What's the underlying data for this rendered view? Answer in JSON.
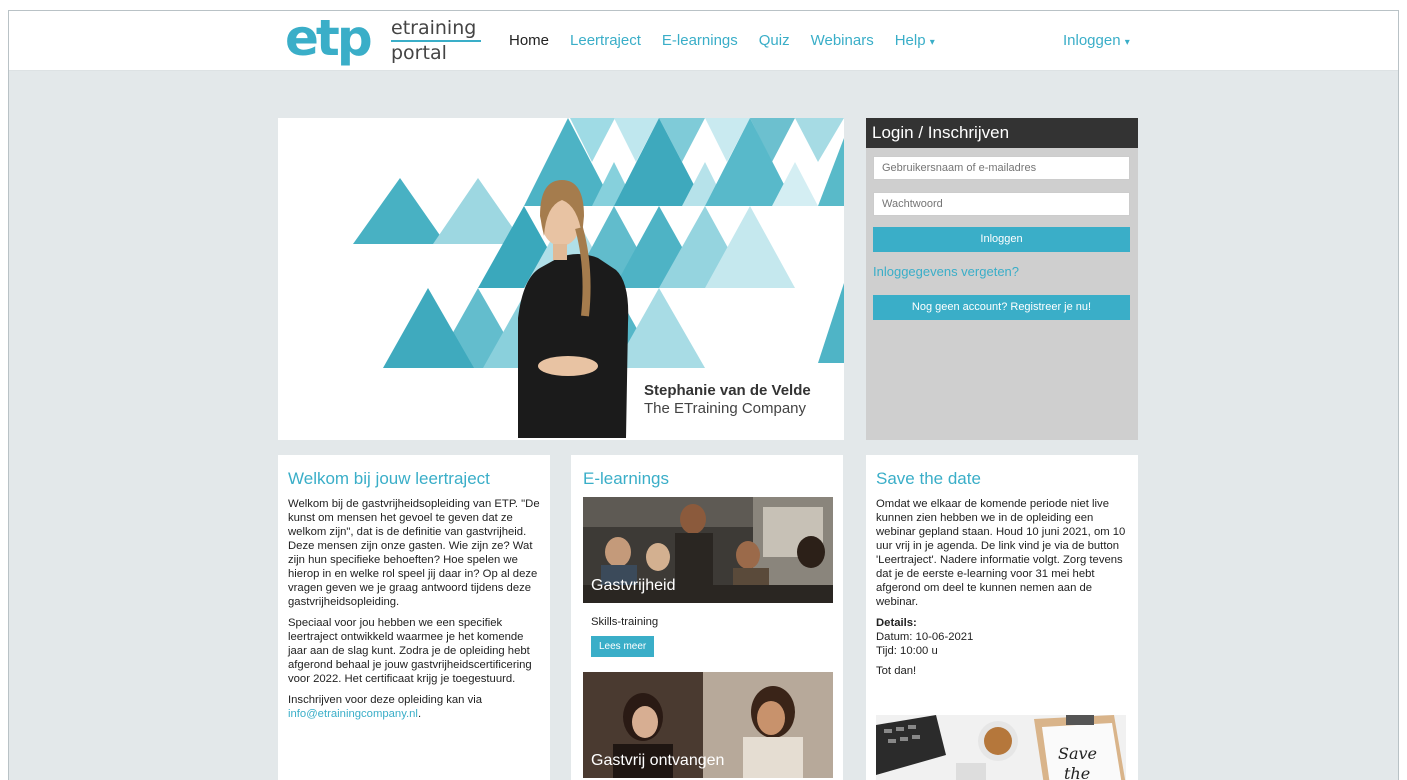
{
  "logo": {
    "etp": "etp",
    "line1": "etraining",
    "line2": "portal"
  },
  "nav": {
    "items": [
      {
        "label": "Home",
        "active": true
      },
      {
        "label": "Leertraject"
      },
      {
        "label": "E-learnings"
      },
      {
        "label": "Quiz"
      },
      {
        "label": "Webinars"
      },
      {
        "label": "Help",
        "has_caret": true
      }
    ],
    "login_label": "Inloggen"
  },
  "hero": {
    "presenter_name": "Stephanie van de Velde",
    "presenter_company": "The ETraining Company"
  },
  "login": {
    "title": "Login / Inschrijven",
    "username_placeholder": "Gebruikersnaam of e-mailadres",
    "password_placeholder": "Wachtwoord",
    "login_button": "Inloggen",
    "forgot_link": "Inloggegevens vergeten?",
    "register_button": "Nog geen account? Registreer je nu!"
  },
  "welcome": {
    "title": "Welkom bij jouw leertraject",
    "p1": "Welkom bij de gastvrijheidsopleiding van ETP. \"De kunst om mensen het gevoel te geven dat ze welkom zijn\", dat is de definitie van gastvrijheid. Deze mensen zijn onze gasten. Wie zijn ze? Wat zijn hun specifieke behoeften? Hoe spelen we hierop in en welke rol speel jij daar in? Op al deze vragen geven we je graag antwoord tijdens deze gastvrijheidsopleiding.",
    "p2": "Speciaal voor jou hebben we een specifiek leertraject ontwikkeld waarmee je het komende jaar aan de slag kunt. Zodra je de opleiding hebt afgerond behaal je jouw gastvrijheidscertificering voor 2022. Het certificaat krijg je toegestuurd.",
    "p3_text": "Inschrijven voor deze opleiding kan via",
    "p3_email": "info@etrainingcompany.nl",
    "p3_end": "."
  },
  "elearnings": {
    "title": "E-learnings",
    "items": [
      {
        "caption": "Gastvrijheid",
        "type": "Skills-training",
        "button": "Lees meer"
      },
      {
        "caption": "Gastvrij ontvangen"
      }
    ]
  },
  "save_the_date": {
    "title": "Save the date",
    "body": "Omdat we elkaar de komende periode niet live kunnen zien hebben we in de opleiding een webinar gepland staan. Houd 10 juni 2021, om 10 uur vrij in je agenda. De link vind je via de button 'Leertraject'. Nadere informatie volgt. Zorg tevens dat je de eerste e-learning voor 31 mei hebt afgerond om deel te kunnen nemen aan de webinar.",
    "details_label": "Details:",
    "date_line": "Datum: 10-06-2021",
    "time_line": "Tijd: 10:00 u",
    "closing": "Tot dan!",
    "image_text_1": "Save",
    "image_text_2": "the"
  },
  "colors": {
    "accent": "#3aaec8",
    "dark": "#333333",
    "background": "#e3e8ea",
    "login_panel": "#cfcfcf"
  }
}
